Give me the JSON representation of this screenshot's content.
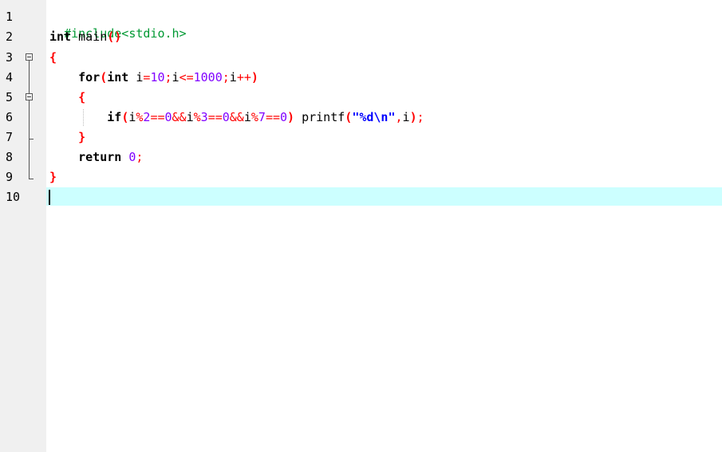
{
  "editor": {
    "line_numbers": [
      "1",
      "2",
      "3",
      "4",
      "5",
      "6",
      "7",
      "8",
      "9",
      "10"
    ],
    "lines": [
      [
        "#include<stdio.h>"
      ],
      [
        "int",
        " main",
        "()"
      ],
      [
        "{"
      ],
      [
        "    ",
        "for",
        "(",
        "int",
        " i",
        "=",
        "10",
        ";",
        "i",
        "<=",
        "1000",
        ";",
        "i",
        "++",
        ")"
      ],
      [
        "    ",
        "{"
      ],
      [
        "        ",
        "if",
        "(",
        "i",
        "%",
        "2",
        "==",
        "0",
        "&&",
        "i",
        "%",
        "3",
        "==",
        "0",
        "&&",
        "i",
        "%",
        "7",
        "==",
        "0",
        ")",
        " printf",
        "(",
        "\"%d\\n\"",
        ",",
        "i",
        ")",
        ";"
      ],
      [
        "    ",
        "}"
      ],
      [
        "    ",
        "return",
        " ",
        "0",
        ";"
      ],
      [
        "}"
      ],
      [
        ""
      ]
    ]
  }
}
